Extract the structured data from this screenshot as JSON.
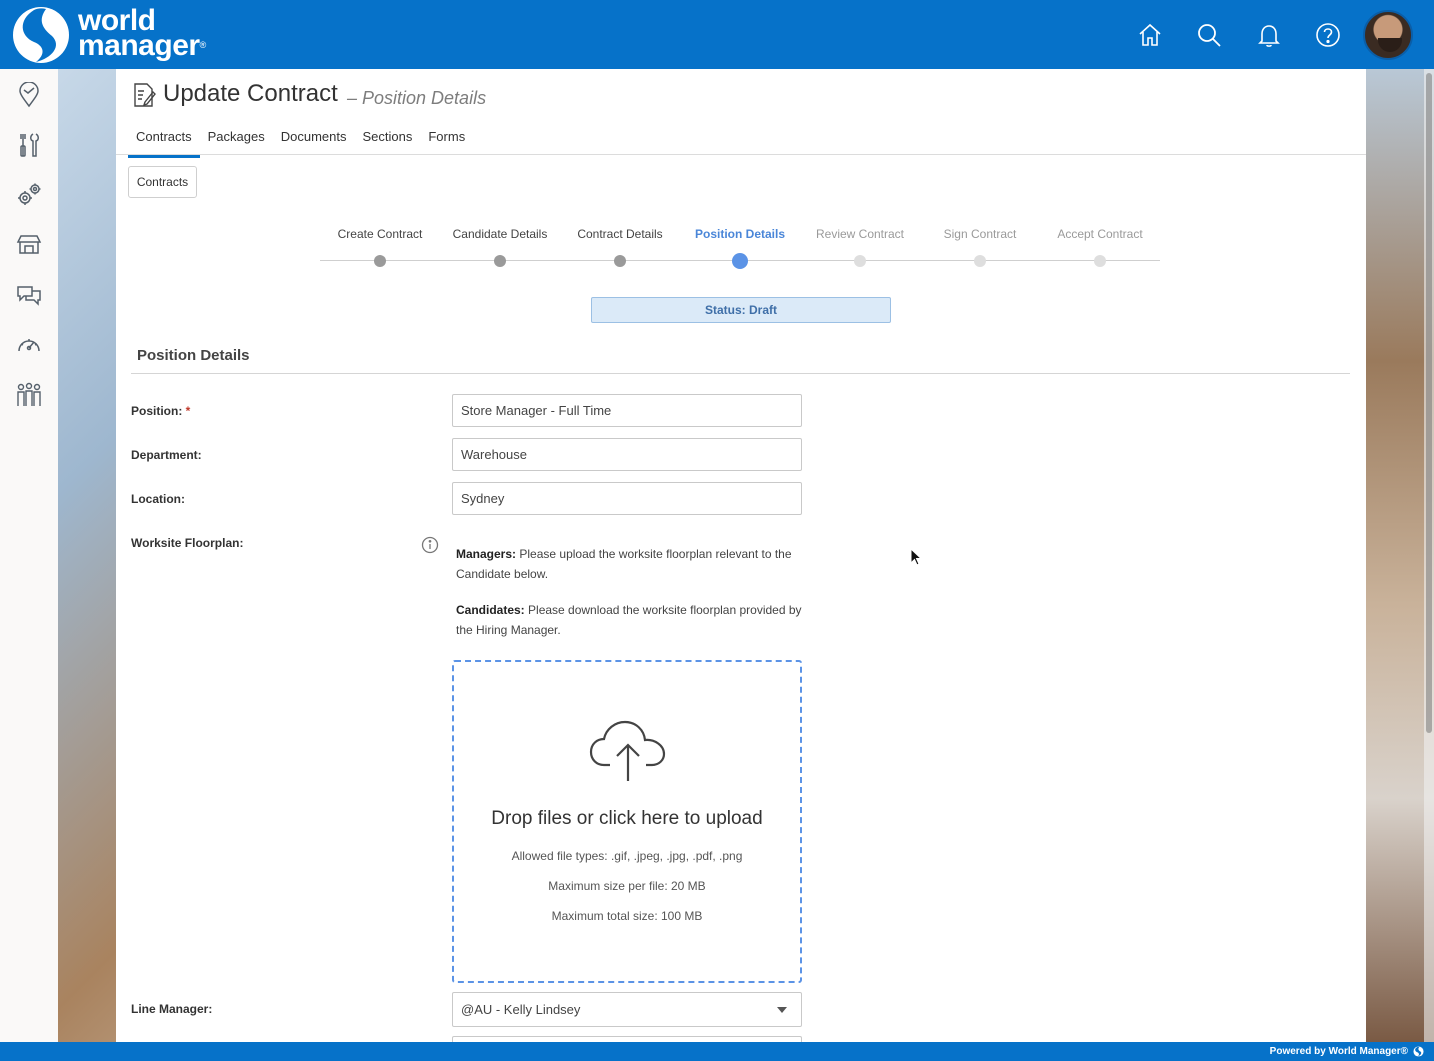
{
  "brand": {
    "name_line1": "world",
    "name_line2": "manager",
    "trademark": "®",
    "color": "#0672c9"
  },
  "topbar": {
    "icons": [
      "home-icon",
      "search-icon",
      "bell-icon",
      "help-icon"
    ],
    "avatar": "user-avatar"
  },
  "sidenav": {
    "items": [
      "map-pin-icon",
      "tools-icon",
      "gears-icon",
      "store-icon",
      "chat-icon",
      "speedometer-icon",
      "people-icon"
    ],
    "expand_label": "»"
  },
  "page": {
    "title": "Update Contract",
    "subtitle": "– Position Details",
    "tabs": [
      {
        "label": "Contracts",
        "active": true
      },
      {
        "label": "Packages",
        "active": false
      },
      {
        "label": "Documents",
        "active": false
      },
      {
        "label": "Sections",
        "active": false
      },
      {
        "label": "Forms",
        "active": false
      }
    ],
    "breadcrumb_button": "Contracts"
  },
  "stepper": {
    "steps": [
      {
        "label": "Create Contract",
        "state": "done"
      },
      {
        "label": "Candidate Details",
        "state": "done"
      },
      {
        "label": "Contract Details",
        "state": "done"
      },
      {
        "label": "Position Details",
        "state": "current"
      },
      {
        "label": "Review Contract",
        "state": "future"
      },
      {
        "label": "Sign Contract",
        "state": "future"
      },
      {
        "label": "Accept Contract",
        "state": "future"
      }
    ],
    "current_color": "#5b93e6"
  },
  "status": "Status: Draft",
  "form": {
    "section_title": "Position Details",
    "position": {
      "label": "Position:",
      "required_mark": "*",
      "value": "Store Manager - Full Time"
    },
    "department": {
      "label": "Department:",
      "value": "Warehouse"
    },
    "location": {
      "label": "Location:",
      "value": "Sydney"
    },
    "floorplan": {
      "label": "Worksite Floorplan:",
      "managers_bold": "Managers:",
      "managers_text": " Please upload the worksite floorplan relevant to the Candidate below.",
      "candidates_bold": "Candidates:",
      "candidates_text": " Please download the worksite floorplan provided by the Hiring Manager."
    },
    "upload": {
      "title": "Drop files or click here to upload",
      "file_types": "Allowed file types: .gif, .jpeg, .jpg, .pdf, .png",
      "max_file": "Maximum size per file: 20 MB",
      "max_total": "Maximum total size: 100 MB"
    },
    "line_manager": {
      "label": "Line Manager:",
      "value": "@AU - Kelly Lindsey"
    }
  },
  "footer": {
    "text": "Powered by World Manager®"
  }
}
